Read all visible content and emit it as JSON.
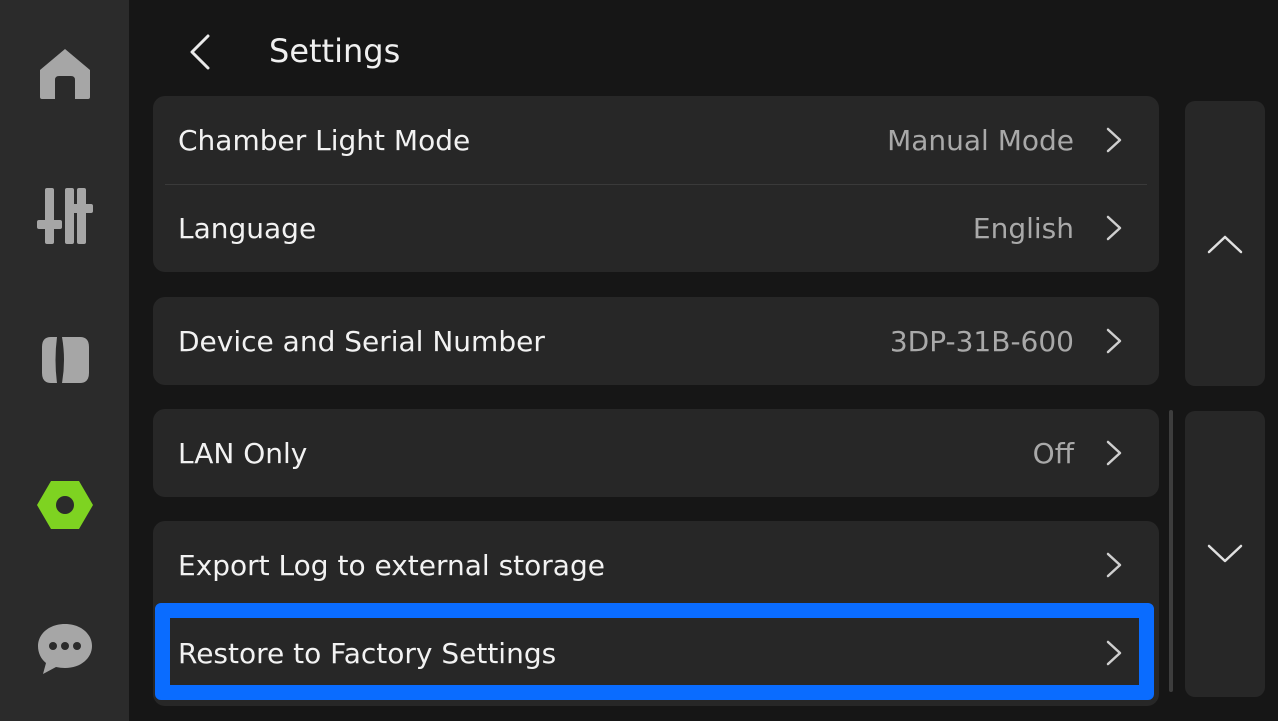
{
  "header": {
    "title": "Settings",
    "back_icon": "chevron-left-icon"
  },
  "nav": {
    "items": [
      {
        "icon": "home-icon",
        "active": false
      },
      {
        "icon": "sliders-icon",
        "active": false
      },
      {
        "icon": "filament-icon",
        "active": false
      },
      {
        "icon": "settings-nut-icon",
        "active": true
      },
      {
        "icon": "chat-bubble-icon",
        "active": false
      }
    ],
    "active_color": "#7ed321",
    "inactive_color": "#a6a6a6"
  },
  "groups": [
    {
      "rows": [
        {
          "label": "Chamber Light Mode",
          "value": "Manual Mode"
        },
        {
          "label": "Language",
          "value": "English"
        }
      ]
    },
    {
      "rows": [
        {
          "label": "Device and Serial Number",
          "value": "3DP-31B-600"
        }
      ]
    },
    {
      "rows": [
        {
          "label": "LAN Only",
          "value": "Off"
        }
      ]
    },
    {
      "rows": [
        {
          "label": "Export Log to external storage",
          "value": ""
        },
        {
          "label": "Restore to Factory Settings",
          "value": ""
        }
      ]
    }
  ],
  "highlight_color": "#0a6cff",
  "pager": {
    "up_icon": "chevron-up-icon",
    "down_icon": "chevron-down-icon"
  }
}
